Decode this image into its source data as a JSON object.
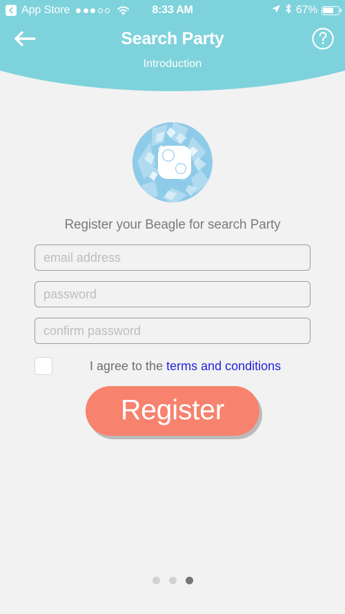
{
  "status_bar": {
    "back_app_label": "App Store",
    "signal_dots_filled": 3,
    "signal_dots_total": 5,
    "wifi_icon": "wifi-icon",
    "time": "8:33 AM",
    "location_icon": "location-arrow-icon",
    "bluetooth_icon": "bluetooth-icon",
    "battery_percent": "67%",
    "battery_level": 67
  },
  "nav": {
    "back_icon": "arrow-left-icon",
    "title": "Search Party",
    "help_icon": "question-mark-circle-icon",
    "subtitle": "Introduction"
  },
  "logo": {
    "icon_name": "beagle-device-logo",
    "description": "circular light-blue fragmented badge with white rounded-square device"
  },
  "form": {
    "heading": "Register your Beagle for search Party",
    "fields": [
      {
        "name": "email-input",
        "placeholder": "email address",
        "value": ""
      },
      {
        "name": "password-input",
        "placeholder": "password",
        "value": ""
      },
      {
        "name": "confirm-password-input",
        "placeholder": "confirm password",
        "value": ""
      }
    ],
    "terms": {
      "checked": false,
      "prefix": "I agree to the ",
      "link_label": "terms and conditions"
    },
    "submit_label": "Register"
  },
  "pagination": {
    "total": 3,
    "active_index": 2
  },
  "colors": {
    "header_teal": "#7ed2dc",
    "background": "#f2f2f2",
    "accent_coral": "#f7826e",
    "link_blue": "#2222dd",
    "text_gray": "#6e6e6e",
    "placeholder_gray": "#bdbdbd",
    "dot_inactive": "#d2d2d2",
    "dot_active": "#757575"
  }
}
